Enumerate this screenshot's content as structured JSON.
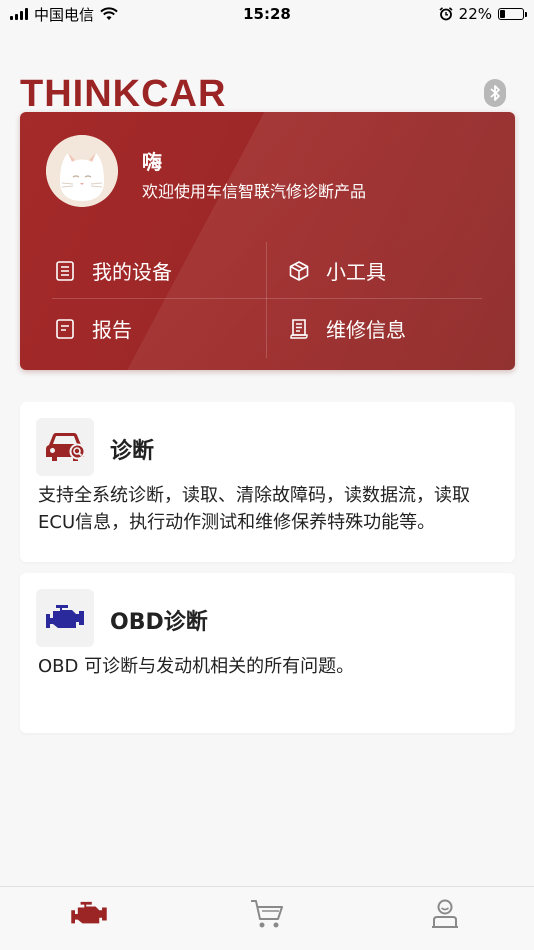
{
  "status_bar": {
    "carrier": "中国电信",
    "time": "15:28",
    "battery": "22%",
    "battery_level": 0.22
  },
  "header": {
    "brand": "THINKCAR",
    "bluetooth_icon": "bluetooth-icon"
  },
  "profile": {
    "name": "嗨",
    "greeting": "欢迎使用车信智联汽修诊断产品"
  },
  "quick_menu": [
    {
      "label": "我的设备",
      "icon": "device-list-icon"
    },
    {
      "label": "小工具",
      "icon": "box-icon"
    },
    {
      "label": "报告",
      "icon": "report-icon"
    },
    {
      "label": "维修信息",
      "icon": "repair-info-icon"
    }
  ],
  "features": [
    {
      "title": "诊断",
      "description": "支持全系统诊断，读取、清除故障码，读数据流，读取ECU信息，执行动作测试和维修保养特殊功能等。",
      "icon": "car-diagnosis-icon"
    },
    {
      "title": "OBD诊断",
      "description": "OBD 可诊断与发动机相关的所有问题。",
      "icon": "engine-icon"
    }
  ],
  "tabbar": [
    {
      "name": "home",
      "icon": "engine-tab-icon",
      "active": true
    },
    {
      "name": "shop",
      "icon": "cart-icon",
      "active": false
    },
    {
      "name": "profile",
      "icon": "user-icon",
      "active": false
    }
  ],
  "colors": {
    "brand": "#9b2424",
    "hero": "#a52a2a",
    "obd_icon": "#2b2a9c",
    "background": "#f7f7f7"
  }
}
